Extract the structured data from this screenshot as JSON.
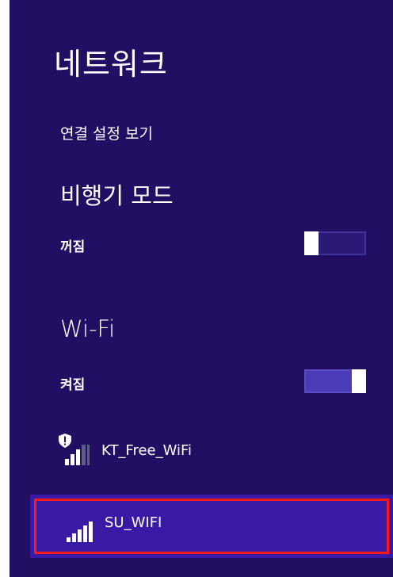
{
  "panel": {
    "title": "네트워크",
    "view_connection_settings": "연결 설정 보기"
  },
  "airplane_mode": {
    "heading": "비행기 모드",
    "state_label": "꺼짐",
    "enabled": false
  },
  "wifi": {
    "heading": "Wi-Fi",
    "state_label": "켜짐",
    "enabled": true
  },
  "networks": [
    {
      "ssid": "KT_Free_WiFi",
      "secured_warning_icon": "shield-exclamation-icon",
      "signal_bars_filled": 3,
      "signal_bars_total": 5,
      "selected": false
    },
    {
      "ssid": "SU_WIFI",
      "signal_bars_filled": 5,
      "signal_bars_total": 5,
      "selected": true
    }
  ],
  "colors": {
    "panel_background": "#220e62",
    "selected_background": "#3a1aa4",
    "highlight_outline": "#ff1a1a",
    "toggle_on": "#4a3bb6"
  }
}
